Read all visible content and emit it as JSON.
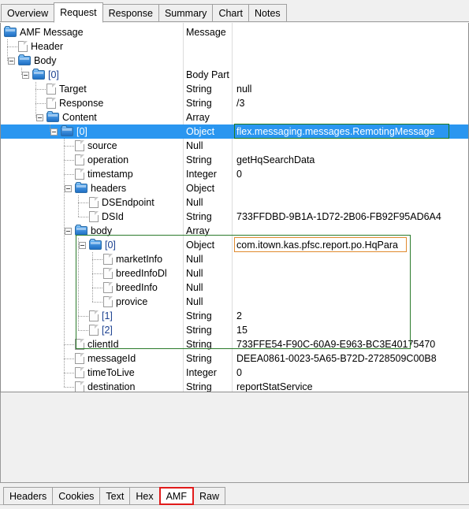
{
  "top_tabs": {
    "items": [
      {
        "label": "Overview",
        "active": false
      },
      {
        "label": "Request",
        "active": true
      },
      {
        "label": "Response",
        "active": false
      },
      {
        "label": "Summary",
        "active": false
      },
      {
        "label": "Chart",
        "active": false
      },
      {
        "label": "Notes",
        "active": false
      }
    ]
  },
  "bottom_tabs": {
    "items": [
      {
        "label": "Headers",
        "active": false
      },
      {
        "label": "Cookies",
        "active": false
      },
      {
        "label": "Text",
        "active": false
      },
      {
        "label": "Hex",
        "active": false
      },
      {
        "label": "AMF",
        "active": true
      },
      {
        "label": "Raw",
        "active": false
      }
    ]
  },
  "colors": {
    "selection": "#2a96f0",
    "green_highlight": "#2b7a2b",
    "orange_highlight": "#e08a2e",
    "red_tab_highlight": "#e11b1b",
    "index_text": "#1a3f8f"
  },
  "tree": {
    "rows": [
      {
        "name": "AMF Message",
        "type": "Message",
        "value": "",
        "depth": 0,
        "icon": "folder-icon",
        "expander": "none",
        "index": false,
        "selected": false
      },
      {
        "name": "Header",
        "type": "",
        "value": "",
        "depth": 1,
        "icon": "file-icon",
        "expander": "none",
        "index": false,
        "selected": false
      },
      {
        "name": "Body",
        "type": "",
        "value": "",
        "depth": 1,
        "icon": "folder-icon",
        "expander": "minus",
        "index": false,
        "selected": false
      },
      {
        "name": "[0]",
        "type": "Body Part",
        "value": "",
        "depth": 2,
        "icon": "folder-icon",
        "expander": "minus",
        "index": true,
        "selected": false
      },
      {
        "name": "Target",
        "type": "String",
        "value": "null",
        "depth": 3,
        "icon": "file-icon",
        "expander": "none",
        "index": false,
        "selected": false
      },
      {
        "name": "Response",
        "type": "String",
        "value": "/3",
        "depth": 3,
        "icon": "file-icon",
        "expander": "none",
        "index": false,
        "selected": false
      },
      {
        "name": "Content",
        "type": "Array",
        "value": "",
        "depth": 3,
        "icon": "folder-icon",
        "expander": "minus",
        "index": false,
        "selected": false
      },
      {
        "name": "[0]",
        "type": "Object",
        "value": "flex.messaging.messages.RemotingMessage",
        "depth": 4,
        "icon": "folder-icon",
        "expander": "minus",
        "index": true,
        "selected": true
      },
      {
        "name": "source",
        "type": "Null",
        "value": "",
        "depth": 5,
        "icon": "file-icon",
        "expander": "none",
        "index": false,
        "selected": false
      },
      {
        "name": "operation",
        "type": "String",
        "value": "getHqSearchData",
        "depth": 5,
        "icon": "file-icon",
        "expander": "none",
        "index": false,
        "selected": false
      },
      {
        "name": "timestamp",
        "type": "Integer",
        "value": "0",
        "depth": 5,
        "icon": "file-icon",
        "expander": "none",
        "index": false,
        "selected": false
      },
      {
        "name": "headers",
        "type": "Object",
        "value": "",
        "depth": 5,
        "icon": "folder-icon",
        "expander": "minus",
        "index": false,
        "selected": false
      },
      {
        "name": "DSEndpoint",
        "type": "Null",
        "value": "",
        "depth": 6,
        "icon": "file-icon",
        "expander": "none",
        "index": false,
        "selected": false
      },
      {
        "name": "DSId",
        "type": "String",
        "value": "733FFDBD-9B1A-1D72-2B06-FB92F95AD6A4",
        "depth": 6,
        "icon": "file-icon",
        "expander": "none",
        "index": false,
        "selected": false
      },
      {
        "name": "body",
        "type": "Array",
        "value": "",
        "depth": 5,
        "icon": "folder-icon",
        "expander": "minus",
        "index": false,
        "selected": false
      },
      {
        "name": "[0]",
        "type": "Object",
        "value": "com.itown.kas.pfsc.report.po.HqPara",
        "depth": 6,
        "icon": "folder-icon",
        "expander": "minus",
        "index": true,
        "selected": false
      },
      {
        "name": "marketInfo",
        "type": "Null",
        "value": "",
        "depth": 7,
        "icon": "file-icon",
        "expander": "none",
        "index": false,
        "selected": false
      },
      {
        "name": "breedInfoDl",
        "type": "Null",
        "value": "",
        "depth": 7,
        "icon": "file-icon",
        "expander": "none",
        "index": false,
        "selected": false
      },
      {
        "name": "breedInfo",
        "type": "Null",
        "value": "",
        "depth": 7,
        "icon": "file-icon",
        "expander": "none",
        "index": false,
        "selected": false
      },
      {
        "name": "provice",
        "type": "Null",
        "value": "",
        "depth": 7,
        "icon": "file-icon",
        "expander": "none",
        "index": false,
        "selected": false
      },
      {
        "name": "[1]",
        "type": "String",
        "value": "2",
        "depth": 6,
        "icon": "file-icon",
        "expander": "none",
        "index": true,
        "selected": false
      },
      {
        "name": "[2]",
        "type": "String",
        "value": "15",
        "depth": 6,
        "icon": "file-icon",
        "expander": "none",
        "index": true,
        "selected": false
      },
      {
        "name": "clientId",
        "type": "String",
        "value": "733FFE54-F90C-60A9-E963-BC3E40175470",
        "depth": 5,
        "icon": "file-icon",
        "expander": "none",
        "index": false,
        "selected": false
      },
      {
        "name": "messageId",
        "type": "String",
        "value": "DEEA0861-0023-5A65-B72D-2728509C00B8",
        "depth": 5,
        "icon": "file-icon",
        "expander": "none",
        "index": false,
        "selected": false
      },
      {
        "name": "timeToLive",
        "type": "Integer",
        "value": "0",
        "depth": 5,
        "icon": "file-icon",
        "expander": "none",
        "index": false,
        "selected": false
      },
      {
        "name": "destination",
        "type": "String",
        "value": "reportStatService",
        "depth": 5,
        "icon": "file-icon",
        "expander": "none",
        "index": false,
        "selected": false
      }
    ]
  }
}
